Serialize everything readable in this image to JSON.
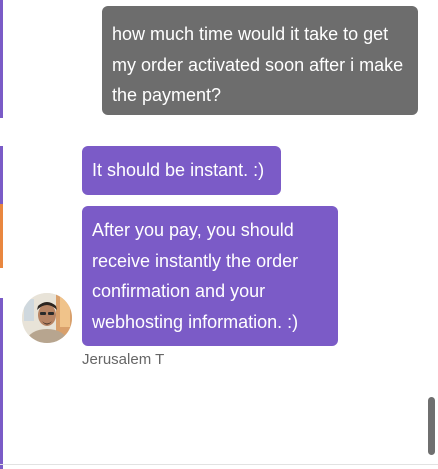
{
  "conversation": {
    "outgoing_message": "how much time would it take to get my order activated soon after i make the payment?",
    "incoming_messages": [
      "It should be instant. :)",
      "After you pay, you should receive instantly the order confirmation and your webhosting information. :)"
    ],
    "agent": {
      "name": "Jerusalem T",
      "avatar_icon": "person-photo-icon"
    }
  },
  "colors": {
    "outgoing_bubble": "#6d6d6d",
    "incoming_bubble": "#7b5bc7",
    "sender_text": "#666666",
    "scrollbar_thumb": "#6f6f6f",
    "edge_accent": "#e9873f"
  }
}
